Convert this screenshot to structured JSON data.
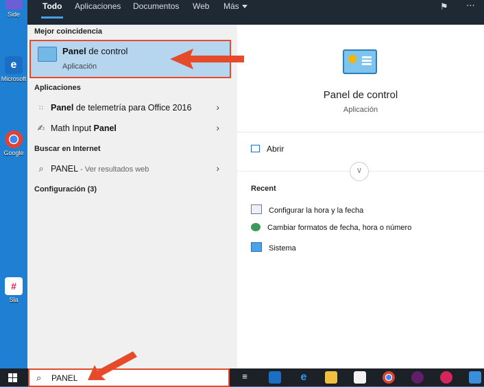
{
  "desktop": {
    "icons": [
      {
        "label": "Side",
        "icon": "sidebar-app-icon"
      },
      {
        "label": "Microsoft",
        "icon": "edge-icon"
      },
      {
        "label": "Google",
        "icon": "chrome-icon"
      },
      {
        "label": "Sla",
        "icon": "slack-icon"
      }
    ]
  },
  "topbar": {
    "tabs": [
      "Todo",
      "Aplicaciones",
      "Documentos",
      "Web",
      "Más"
    ],
    "feedback_icon": "feedback-icon",
    "more_icon": "ellipsis-icon"
  },
  "results": {
    "best_match_heading": "Mejor coincidencia",
    "best_match": {
      "title_bold": "Panel",
      "title_rest": " de control",
      "subtitle": "Aplicación",
      "icon": "control-panel-icon"
    },
    "apps_heading": "Aplicaciones",
    "apps": [
      {
        "bold": "Panel",
        "rest": " de telemetría para Office 2016",
        "icon": "telemetry-icon"
      },
      {
        "pre": "Math Input ",
        "bold": "Panel",
        "icon": "math-input-icon"
      }
    ],
    "web_heading": "Buscar en Internet",
    "web": {
      "query": "PANEL",
      "suffix": " - Ver resultados web",
      "icon": "search-icon"
    },
    "settings_heading": "Configuración (3)"
  },
  "detail": {
    "title": "Panel de control",
    "subtitle": "Aplicación",
    "open_label": "Abrir",
    "recent_heading": "Recent",
    "recent": [
      {
        "label": "Configurar la hora y la fecha",
        "icon": "date-time-icon"
      },
      {
        "label": "Cambiar formatos de fecha, hora o número",
        "icon": "region-globe-icon"
      },
      {
        "label": "Sistema",
        "icon": "system-monitor-icon"
      }
    ]
  },
  "taskbar": {
    "search_value": "PANEL",
    "icons": [
      "task-view-icon",
      "mail-icon",
      "edge-icon",
      "file-explorer-icon",
      "store-icon",
      "chrome-icon",
      "slack-icon",
      "app-icon",
      "photos-icon"
    ]
  },
  "colors": {
    "highlight": "#b6d5ef",
    "annotation_red": "#e54a2a",
    "topbar": "#1f2933",
    "desktop": "#1e7fd3"
  }
}
